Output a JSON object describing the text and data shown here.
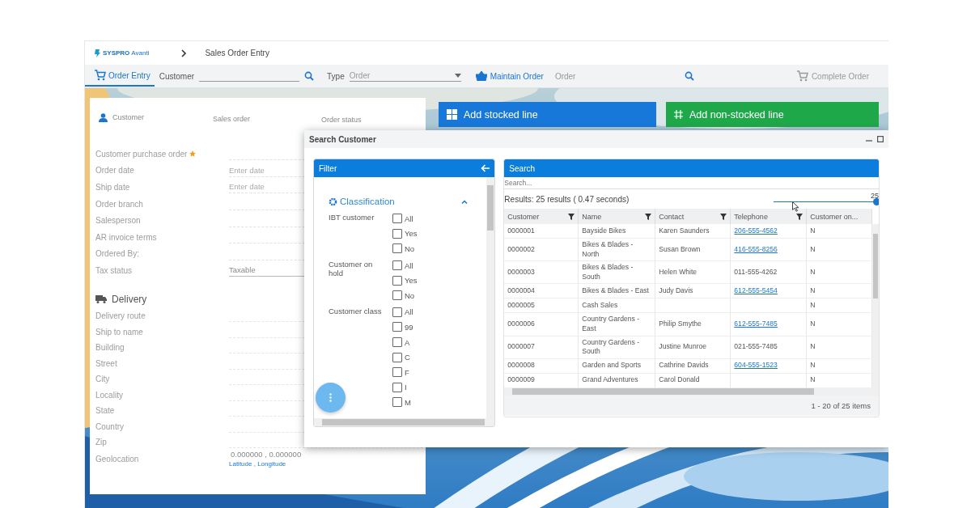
{
  "header": {
    "logo": {
      "brand": "SYSPRO",
      "product": "Avanti"
    },
    "breadcrumb": "Sales Order Entry"
  },
  "toolbar": {
    "tab": {
      "label": "Order Entry",
      "selected": true
    },
    "customer_field": {
      "label": "Customer"
    },
    "type_field": {
      "label": "Type",
      "placeholder": "Order"
    },
    "maintain_order": "Maintain Order",
    "order_field": {
      "placeholder": "Order"
    },
    "complete_order": {
      "label": "Complete Order",
      "disabled": true
    }
  },
  "order_form": {
    "header_labels": [
      "Customer",
      "Sales order",
      "Order status"
    ],
    "fields": [
      {
        "label": "Customer purchase order",
        "required": true
      },
      {
        "label": "Order date",
        "placeholder": "Enter date",
        "required": false
      },
      {
        "label": "Ship date",
        "placeholder": "Enter date",
        "required": false
      },
      {
        "label": "Order branch",
        "required": false
      },
      {
        "label": "Salesperson",
        "required": false
      },
      {
        "label": "AR invoice terms",
        "required": false
      },
      {
        "label": "Ordered By:",
        "required": false
      },
      {
        "label": "Tax status",
        "value": "Taxable",
        "required": false
      }
    ],
    "delivery": {
      "title": "Delivery",
      "fields": [
        {
          "label": "Delivery route"
        },
        {
          "label": "Ship to name"
        },
        {
          "label": "Building"
        },
        {
          "label": "Street"
        },
        {
          "label": "City"
        },
        {
          "label": "Locality"
        },
        {
          "label": "State"
        },
        {
          "label": "Country"
        },
        {
          "label": "Zip"
        },
        {
          "label": "Geolocation",
          "value": "0.000000 , 0.000000",
          "link": "Latitude , Longitude"
        }
      ]
    }
  },
  "actions": [
    {
      "label": "Add stocked line",
      "kind": "stocked"
    },
    {
      "label": "Add non-stocked line",
      "kind": "non-stocked"
    }
  ],
  "dialog": {
    "title": "Search Customer",
    "filter": {
      "title": "Filter",
      "section": {
        "title": "Classification",
        "expanded": true,
        "groups": [
          {
            "label": "IBT customer",
            "options": [
              {
                "label": "All",
                "checked": false
              },
              {
                "label": "Yes",
                "checked": false
              },
              {
                "label": "No",
                "checked": false
              }
            ]
          },
          {
            "label": "Customer on hold",
            "options": [
              {
                "label": "All",
                "checked": false
              },
              {
                "label": "Yes",
                "checked": false
              },
              {
                "label": "No",
                "checked": false
              }
            ]
          },
          {
            "label": "Customer class",
            "options": [
              {
                "label": "All",
                "checked": false
              },
              {
                "label": "99",
                "checked": false
              },
              {
                "label": "A",
                "checked": false
              },
              {
                "label": "C",
                "checked": false
              },
              {
                "label": "F",
                "checked": false
              },
              {
                "label": "I",
                "checked": false
              },
              {
                "label": "M",
                "checked": false
              }
            ]
          }
        ]
      }
    },
    "search": {
      "title": "Search",
      "placeholder": "Search...",
      "results": "Results: 25 results ( 0.47 seconds)",
      "page_size": {
        "reading": "25",
        "level": 1
      },
      "table": {
        "columns": [
          {
            "label": "Customer",
            "filter": true
          },
          {
            "label": "Name",
            "filter": true
          },
          {
            "label": "Contact",
            "filter": true
          },
          {
            "label": "Telephone",
            "filter": true
          },
          {
            "label": "Customer on...",
            "filter": false
          }
        ],
        "rows": [
          {
            "customer": "0000001",
            "name": "Bayside Bikes",
            "contact": "Karen Saunders",
            "telephone": "206-555-4562",
            "phone_link": true,
            "on_hold": "N"
          },
          {
            "customer": "0000002",
            "name": "Bikes & Blades - North",
            "contact": "Susan Brown",
            "telephone": "416-555-8256",
            "phone_link": true,
            "on_hold": "N"
          },
          {
            "customer": "0000003",
            "name": "Bikes & Blades - South",
            "contact": "Helen White",
            "telephone": "011-555-4262",
            "phone_link": false,
            "on_hold": "N"
          },
          {
            "customer": "0000004",
            "name": "Bikes & Blades - East",
            "contact": "Judy Davis",
            "telephone": "612-555-5454",
            "phone_link": true,
            "on_hold": "N"
          },
          {
            "customer": "0000005",
            "name": "Cash Sales",
            "on_hold": "N"
          },
          {
            "customer": "0000006",
            "name": "Country Gardens - East",
            "contact": "Philip Smythe",
            "telephone": "612-555-7485",
            "phone_link": true,
            "on_hold": "N"
          },
          {
            "customer": "0000007",
            "name": "Country Gardens - South",
            "contact": "Justine Munroe",
            "telephone": "021-555-7485",
            "phone_link": false,
            "on_hold": "N"
          },
          {
            "customer": "0000008",
            "name": "Garden and Sports",
            "contact": "Cathrine Davids",
            "telephone": "604-555-1523",
            "phone_link": true,
            "on_hold": "N"
          },
          {
            "customer": "0000009",
            "name": "Grand Adventures",
            "contact": "Carol Donald",
            "on_hold": "N"
          }
        ]
      },
      "footer": "1 - 20 of 25 items"
    }
  }
}
